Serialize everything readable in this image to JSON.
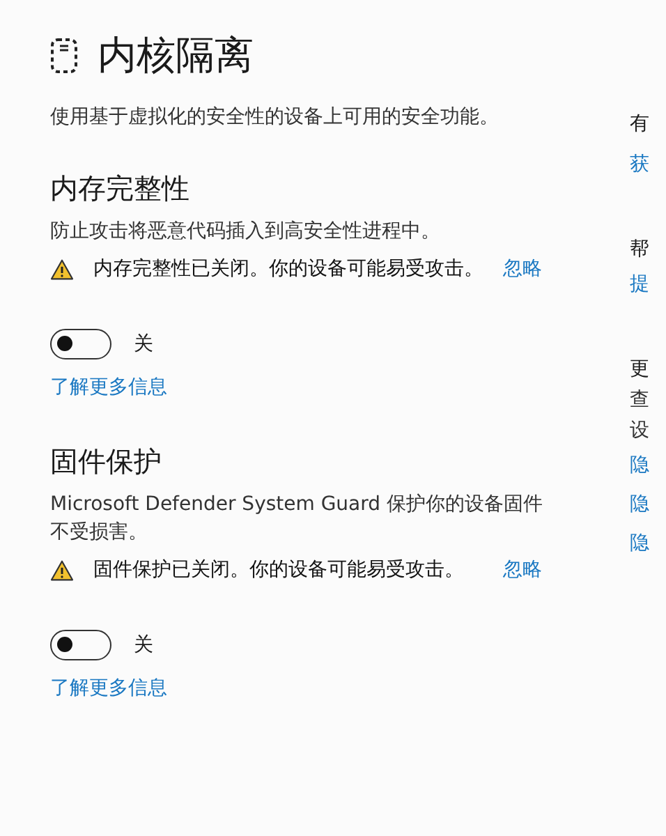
{
  "page": {
    "title": "内核隔离",
    "description": "使用基于虚拟化的安全性的设备上可用的安全功能。"
  },
  "sections": [
    {
      "heading": "内存完整性",
      "description": "防止攻击将恶意代码插入到高安全性进程中。",
      "warning": {
        "text": "内存完整性已关闭。你的设备可能易受攻击。",
        "dismiss": "忽略"
      },
      "toggle": {
        "on": false,
        "label": "关"
      },
      "link": "了解更多信息"
    },
    {
      "heading": "固件保护",
      "description": "Microsoft Defender System Guard 保护你的设备固件不受损害。",
      "warning": {
        "text": "固件保护已关闭。你的设备可能易受攻击。",
        "dismiss": "忽略"
      },
      "toggle": {
        "on": false,
        "label": "关"
      },
      "link": "了解更多信息"
    }
  ],
  "side_panel": [
    {
      "heading": "有",
      "links": [
        "获"
      ]
    },
    {
      "heading": "帮",
      "links": [
        "提"
      ]
    },
    {
      "heading": "更",
      "text_lines": [
        "查",
        "设"
      ],
      "links": [
        "隐",
        "隐",
        "隐"
      ]
    }
  ]
}
